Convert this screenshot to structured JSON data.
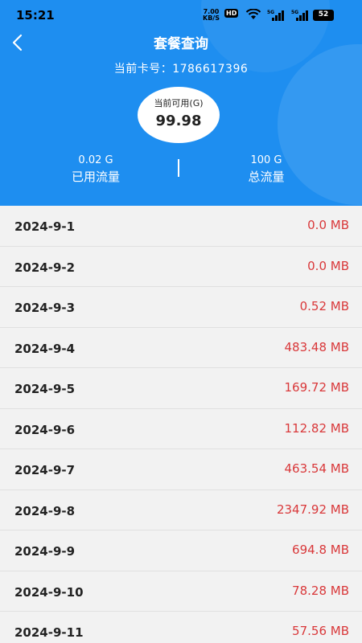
{
  "status_bar": {
    "time": "15:21",
    "net_speed": "7.00",
    "net_unit": "KB/S",
    "hd": "HD",
    "sig1_label": "5G",
    "sig2_label": "5G",
    "battery": "52"
  },
  "header": {
    "title": "套餐查询",
    "card_label": "当前卡号：",
    "card_number": "1786617396",
    "available_label": "当前可用(G)",
    "available_value": "99.98",
    "used_value": "0.02 G",
    "used_label": "已用流量",
    "total_value": "100 G",
    "total_label": "总流量"
  },
  "usage_list": [
    {
      "date": "2024-9-1",
      "usage": "0.0 MB"
    },
    {
      "date": "2024-9-2",
      "usage": "0.0 MB"
    },
    {
      "date": "2024-9-3",
      "usage": "0.52 MB"
    },
    {
      "date": "2024-9-4",
      "usage": "483.48 MB"
    },
    {
      "date": "2024-9-5",
      "usage": "169.72 MB"
    },
    {
      "date": "2024-9-6",
      "usage": "112.82 MB"
    },
    {
      "date": "2024-9-7",
      "usage": "463.54 MB"
    },
    {
      "date": "2024-9-8",
      "usage": "2347.92 MB"
    },
    {
      "date": "2024-9-9",
      "usage": "694.8 MB"
    },
    {
      "date": "2024-9-10",
      "usage": "78.28 MB"
    },
    {
      "date": "2024-9-11",
      "usage": "57.56 MB"
    }
  ],
  "colors": {
    "header_bg": "#1e8ef0",
    "usage_text": "#d9383a",
    "list_bg": "#f2f2f2"
  }
}
